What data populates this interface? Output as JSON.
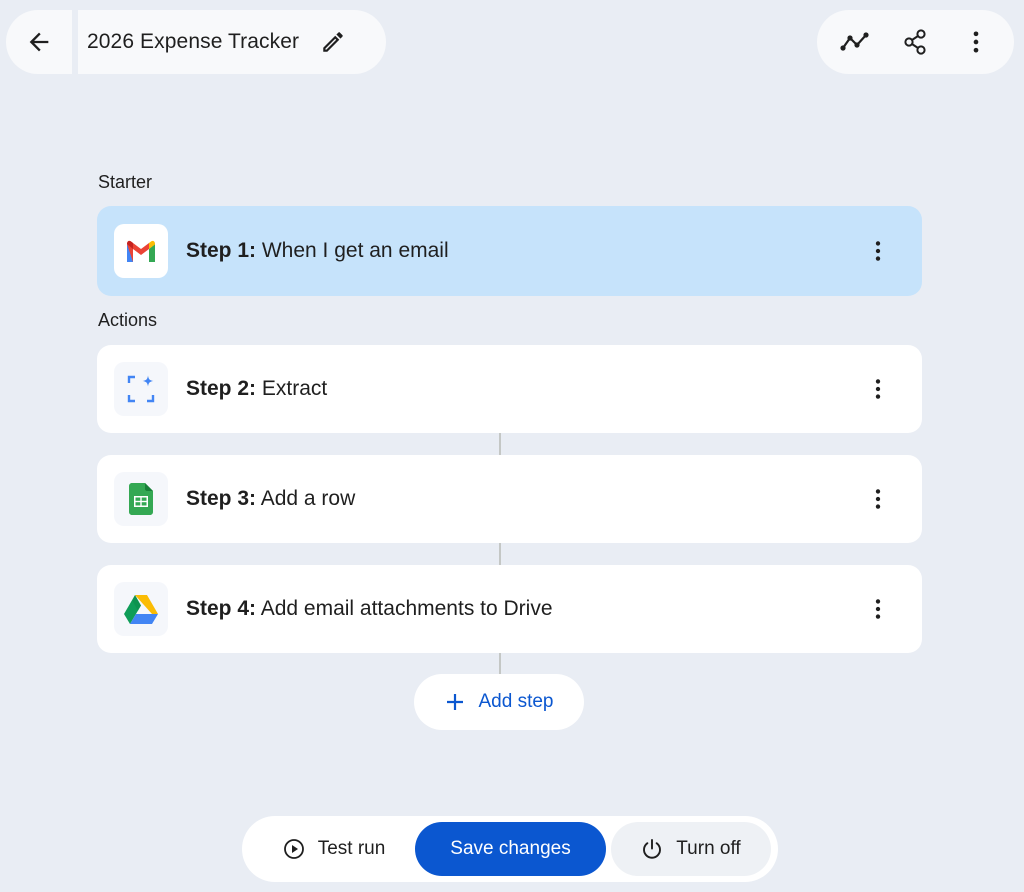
{
  "header": {
    "title": "2026 Expense Tracker"
  },
  "sections": {
    "starter_label": "Starter",
    "actions_label": "Actions"
  },
  "steps": [
    {
      "prefix": "Step 1:",
      "text": "When I get an email",
      "icon": "gmail-icon"
    },
    {
      "prefix": "Step 2:",
      "text": "Extract",
      "icon": "extract-sparkle-icon"
    },
    {
      "prefix": "Step 3:",
      "text": "Add a row",
      "icon": "sheets-icon"
    },
    {
      "prefix": "Step 4:",
      "text": "Add email attachments to Drive",
      "icon": "drive-icon"
    }
  ],
  "add_step_label": "Add step",
  "bottom_bar": {
    "test_run_label": "Test run",
    "save_label": "Save changes",
    "turn_off_label": "Turn off"
  },
  "colors": {
    "background": "#e9edf4",
    "active_step": "#c6e3fb",
    "primary": "#0b57d0"
  }
}
